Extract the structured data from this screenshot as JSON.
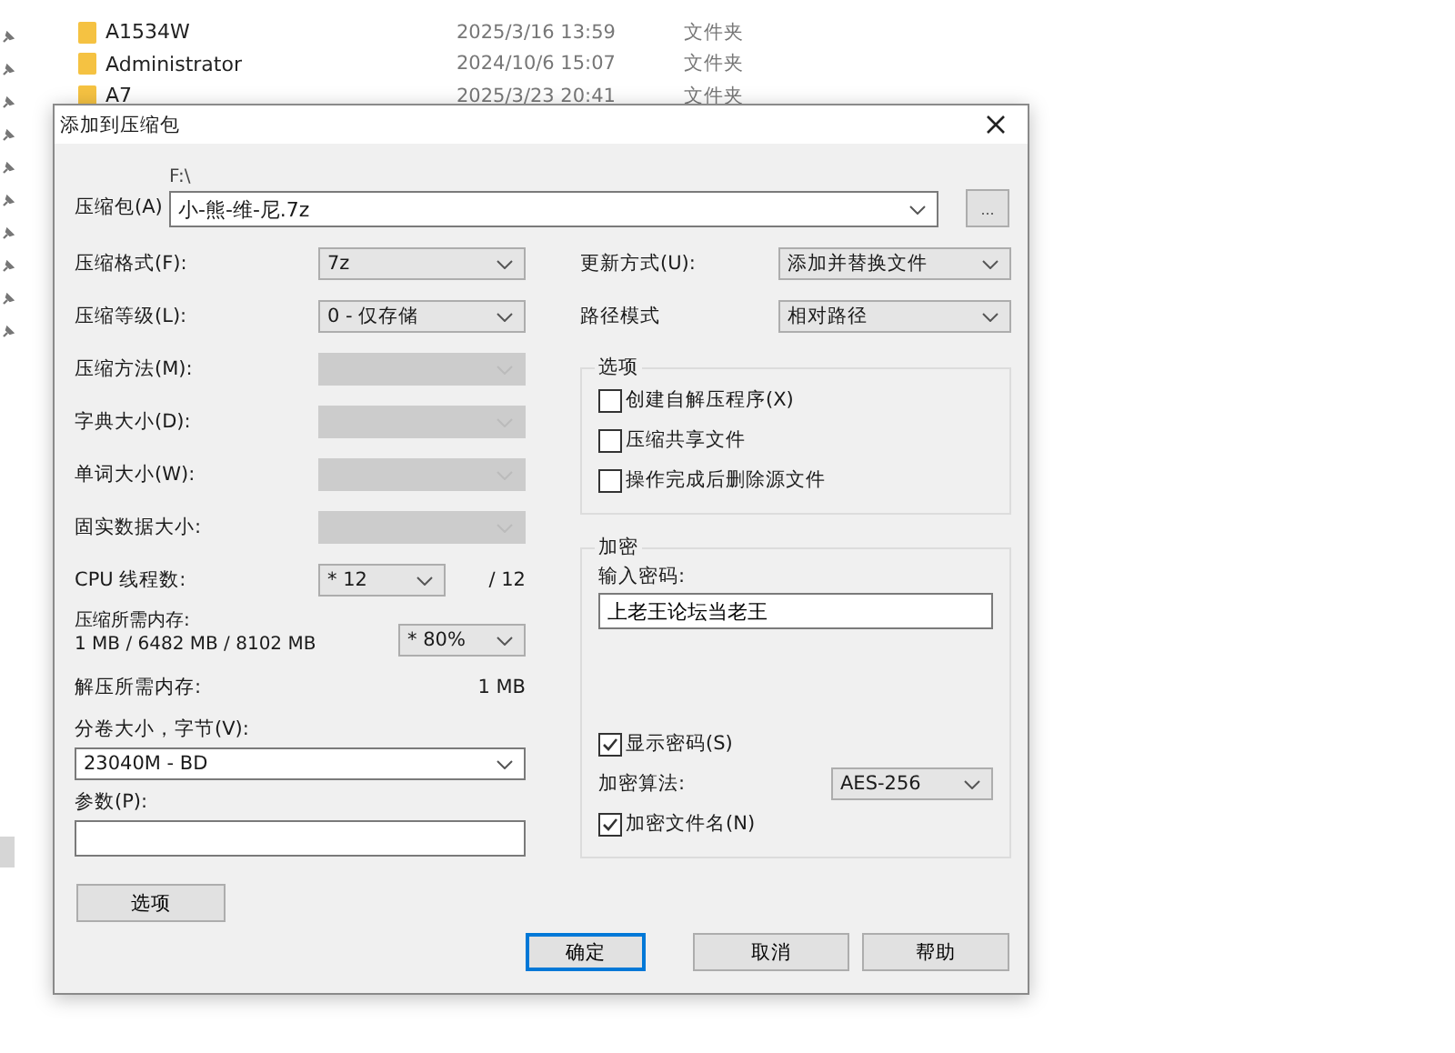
{
  "explorer": {
    "files": [
      {
        "name": "A1534W",
        "date": "2025/3/16 13:59",
        "type": "文件夹"
      },
      {
        "name": "Administrator",
        "date": "2024/10/6 15:07",
        "type": "文件夹"
      },
      {
        "name": "A7",
        "date": "2025/3/23 20:41",
        "type": "文件夹"
      }
    ]
  },
  "dialog": {
    "title": "添加到压缩包",
    "archive": {
      "label": "压缩包(A)",
      "folder": "F:\\",
      "value": "小-熊-维-尼.7z",
      "browse": "..."
    },
    "left": [
      {
        "kind": "select",
        "label": "压缩格式(F):",
        "value": "7z",
        "disabled": false
      },
      {
        "kind": "select",
        "label": "压缩等级(L):",
        "value": "0 - 仅存储",
        "disabled": false
      },
      {
        "kind": "select",
        "label": "压缩方法(M):",
        "disabled": true
      },
      {
        "kind": "select",
        "label": "字典大小(D):",
        "disabled": true
      },
      {
        "kind": "select",
        "label": "单词大小(W):",
        "disabled": true
      },
      {
        "kind": "select",
        "label": "固实数据大小:",
        "disabled": true
      },
      {
        "kind": "threads",
        "label": "CPU 线程数:",
        "value": "* 12",
        "total": "/ 12"
      },
      {
        "kind": "memory",
        "label": "压缩所需内存:",
        "detail": "1 MB / 6482 MB / 8102 MB",
        "value": "* 80%"
      },
      {
        "kind": "info",
        "label": "解压所需内存:",
        "value": "1 MB"
      },
      {
        "kind": "wide-select",
        "label": "分卷大小，字节(V):",
        "value": "23040M - BD"
      },
      {
        "kind": "input",
        "label": "参数(P):"
      }
    ],
    "options_button": "选项",
    "right": [
      {
        "label": "更新方式(U):",
        "value": "添加并替换文件"
      },
      {
        "label": "路径模式",
        "value": "相对路径"
      }
    ],
    "options_group": {
      "title": "选项",
      "checkboxes": [
        {
          "label": "创建自解压程序(X)",
          "checked": false
        },
        {
          "label": "压缩共享文件",
          "checked": false
        },
        {
          "label": "操作完成后删除源文件",
          "checked": false
        }
      ]
    },
    "encryption": {
      "title": "加密",
      "password_label": "输入密码:",
      "password": "上老王论坛当老王",
      "show_password": {
        "label": "显示密码(S)",
        "checked": true
      },
      "method_label": "加密算法:",
      "method": "AES-256",
      "encrypt_names": {
        "label": "加密文件名(N)",
        "checked": true
      }
    },
    "buttons": [
      {
        "label": "确定",
        "focused": true
      },
      {
        "label": "取消",
        "focused": false
      },
      {
        "label": "帮助",
        "focused": false
      }
    ]
  }
}
